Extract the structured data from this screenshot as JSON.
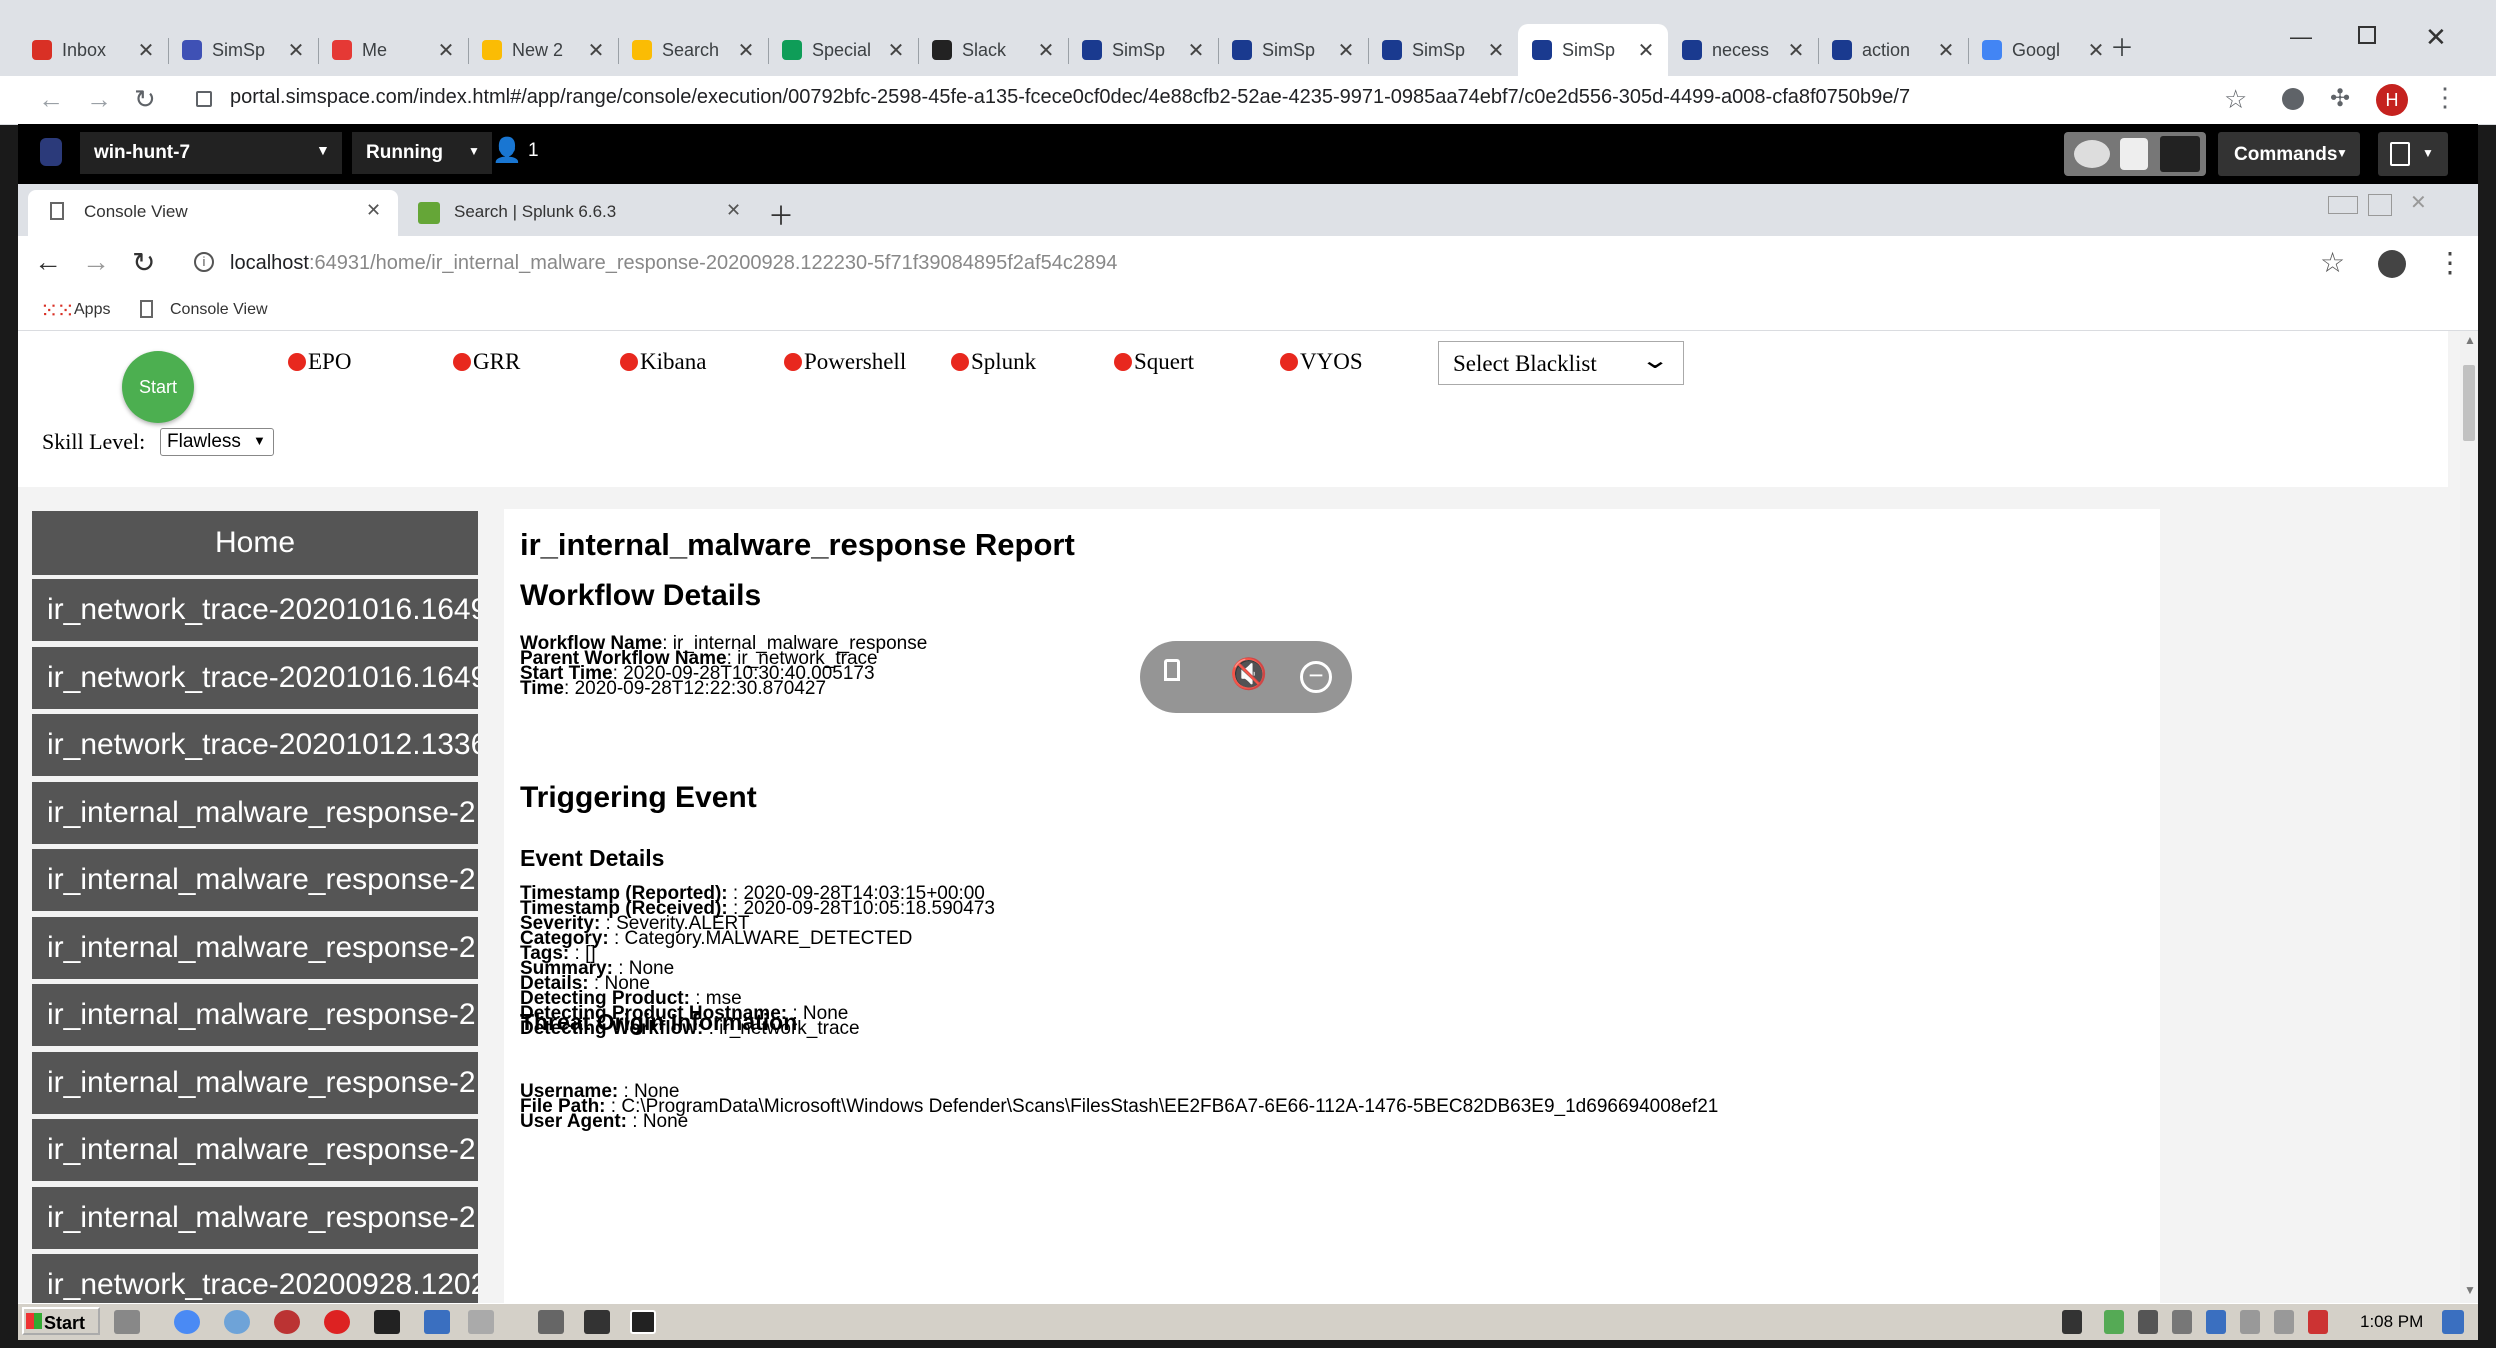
{
  "outer_tabs": [
    {
      "title": "Inbox",
      "color": "#d93025"
    },
    {
      "title": "SimSp",
      "color": "#3f51b5"
    },
    {
      "title": "Me",
      "color": "#e53935"
    },
    {
      "title": "New 2",
      "color": "#fbbc04"
    },
    {
      "title": "Search",
      "color": "#fbbc04"
    },
    {
      "title": "Special",
      "color": "#0f9d58"
    },
    {
      "title": "Slack",
      "color": "#222222"
    },
    {
      "title": "SimSp",
      "color": "#1a3a8f"
    },
    {
      "title": "SimSp",
      "color": "#1a3a8f"
    },
    {
      "title": "SimSp",
      "color": "#1a3a8f"
    },
    {
      "title": "SimSp",
      "color": "#1a3a8f"
    },
    {
      "title": "necess",
      "color": "#1a3a8f"
    },
    {
      "title": "action",
      "color": "#1a3a8f"
    },
    {
      "title": "Googl",
      "color": "#4285f4"
    }
  ],
  "outer_url": "portal.simspace.com/index.html#/app/range/console/execution/00792bfc-2598-45fe-a135-fcece0cf0dec/4e88cfb2-52ae-4235-9971-0985aa74ebf7/c0e2d556-305d-4499-a008-cfa8f0750b9e/7",
  "profile_initial": "H",
  "app_bar": {
    "vm_name": "win-hunt-7",
    "status": "Running",
    "user_count": "1",
    "commands_label": "Commands"
  },
  "inner_tabs": [
    {
      "title": "Console View"
    },
    {
      "title": "Search | Splunk 6.6.3"
    }
  ],
  "inner_url_host": "localhost",
  "inner_url_rest": ":64931/home/ir_internal_malware_response-20200928.122230-5f71f39084895f2af54c2894",
  "bookmarks": {
    "apps": "Apps",
    "console": "Console View"
  },
  "top_controls": {
    "start_label": "Start",
    "skill_label": "Skill Level:",
    "skill_value": "Flawless",
    "services": [
      "EPO",
      "GRR",
      "Kibana",
      "Powershell",
      "Splunk",
      "Squert",
      "VYOS"
    ],
    "blacklist_label": "Select Blacklist"
  },
  "sidebar": {
    "home": "Home",
    "items": [
      "ir_network_trace-20201016.1649",
      "ir_network_trace-20201016.1649",
      "ir_network_trace-20201012.1336",
      "ir_internal_malware_response-2",
      "ir_internal_malware_response-2",
      "ir_internal_malware_response-2",
      "ir_internal_malware_response-2",
      "ir_internal_malware_response-2",
      "ir_internal_malware_response-2",
      "ir_internal_malware_response-2",
      "ir_network_trace-20200928.1202"
    ]
  },
  "report": {
    "title": "ir_internal_malware_response Report",
    "workflow_heading": "Workflow Details",
    "workflow": [
      {
        "k": "Workflow Name",
        "v": ": ir_internal_malware_response"
      },
      {
        "k": "Parent Workflow Name",
        "v": ": ir_network_trace"
      },
      {
        "k": "Start Time",
        "v": ": 2020-09-28T10:30:40.005173"
      },
      {
        "k": "Time",
        "v": ": 2020-09-28T12:22:30.870427"
      }
    ],
    "trigger_heading": "Triggering Event",
    "event_heading": "Event Details",
    "event": [
      {
        "k": "Timestamp (Reported):",
        "v": " : 2020-09-28T14:03:15+00:00"
      },
      {
        "k": "Timestamp (Received):",
        "v": " : 2020-09-28T10:05:18.590473"
      },
      {
        "k": "Severity:",
        "v": " : Severity.ALERT"
      },
      {
        "k": "Category:",
        "v": " : Category.MALWARE_DETECTED"
      },
      {
        "k": "Tags:",
        "v": " : []"
      },
      {
        "k": "Summary:",
        "v": " : None"
      },
      {
        "k": "Details:",
        "v": " : None"
      },
      {
        "k": "Detecting Product:",
        "v": " : mse"
      },
      {
        "k": "Detecting Product Hostname:",
        "v": " : None"
      },
      {
        "k": "Detecting Workflow:",
        "v": " : ir_network_trace"
      }
    ],
    "origin_heading": "Threat Origin Information",
    "origin": [
      {
        "k": "Username:",
        "v": " : None"
      },
      {
        "k": "File Path:",
        "v": " : C:\\ProgramData\\Microsoft\\Windows Defender\\Scans\\FilesStash\\EE2FB6A7-6E66-112A-1476-5BEC82DB63E9_1d696694008ef21"
      },
      {
        "k": "User Agent:",
        "v": " : None"
      }
    ]
  },
  "taskbar": {
    "start": "Start",
    "clock": "1:08 PM"
  }
}
